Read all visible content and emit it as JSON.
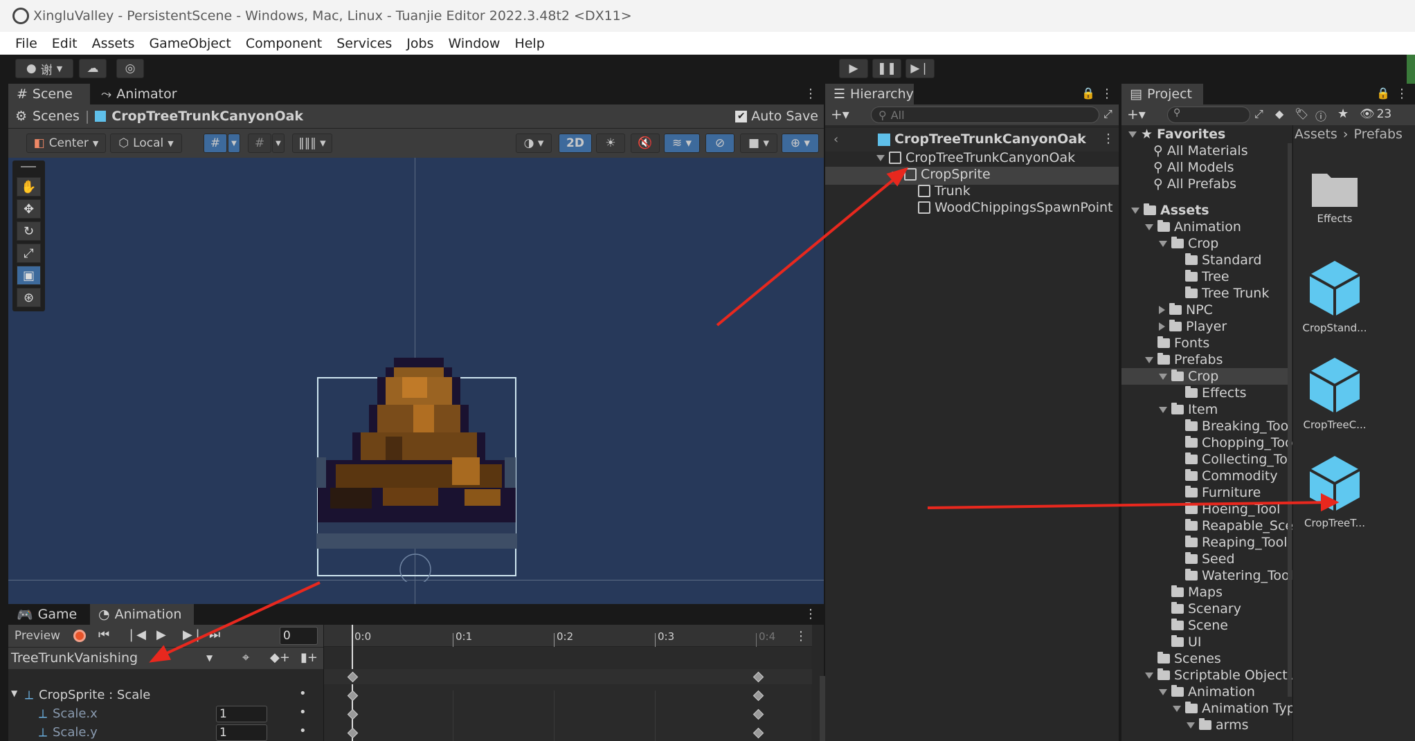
{
  "window": {
    "title": "XingluValley - PersistentScene - Windows, Mac, Linux - Tuanjie Editor 2022.3.48t2 <DX11>"
  },
  "menu": [
    "File",
    "Edit",
    "Assets",
    "GameObject",
    "Component",
    "Services",
    "Jobs",
    "Window",
    "Help"
  ],
  "toolbar": {
    "account_label": "谢",
    "play_icon": "play-icon",
    "pause_icon": "pause-icon",
    "step_icon": "step-icon"
  },
  "scene_panel": {
    "tabs": [
      "Scene",
      "Animator"
    ],
    "breadcrumb_root": "Scenes",
    "breadcrumb_prefab": "CropTreeTrunkCanyonOak",
    "auto_save": "Auto Save",
    "pivot": "Center",
    "space": "Local",
    "mode_2d": "2D"
  },
  "hierarchy": {
    "tab": "Hierarchy",
    "search_placeholder": "All",
    "root": "CropTreeTrunkCanyonOak",
    "items": [
      {
        "label": "CropTreeTrunkCanyonOak",
        "level": 1,
        "expanded": true
      },
      {
        "label": "CropSprite",
        "level": 2,
        "expanded": true,
        "selected": true
      },
      {
        "label": "Trunk",
        "level": 3
      },
      {
        "label": "WoodChippingsSpawnPoint",
        "level": 3
      }
    ]
  },
  "project": {
    "tab": "Project",
    "hidden_count": "23",
    "breadcrumb": [
      "Assets",
      "Prefabs"
    ],
    "favorites_label": "Favorites",
    "favorites": [
      "All Materials",
      "All Models",
      "All Prefabs"
    ],
    "tree": [
      {
        "label": "Assets",
        "level": 0,
        "arrow": "down",
        "bold": true
      },
      {
        "label": "Animation",
        "level": 1,
        "arrow": "down"
      },
      {
        "label": "Crop",
        "level": 2,
        "arrow": "down"
      },
      {
        "label": "Standard",
        "level": 3
      },
      {
        "label": "Tree",
        "level": 3
      },
      {
        "label": "Tree Trunk",
        "level": 3
      },
      {
        "label": "NPC",
        "level": 2,
        "arrow": "right"
      },
      {
        "label": "Player",
        "level": 2,
        "arrow": "right"
      },
      {
        "label": "Fonts",
        "level": 1
      },
      {
        "label": "Prefabs",
        "level": 1,
        "arrow": "down"
      },
      {
        "label": "Crop",
        "level": 2,
        "arrow": "down",
        "selected": true
      },
      {
        "label": "Effects",
        "level": 3
      },
      {
        "label": "Item",
        "level": 2,
        "arrow": "down"
      },
      {
        "label": "Breaking_Tool",
        "level": 3
      },
      {
        "label": "Chopping_Too",
        "level": 3
      },
      {
        "label": "Collecting_To",
        "level": 3
      },
      {
        "label": "Commodity",
        "level": 3
      },
      {
        "label": "Furniture",
        "level": 3
      },
      {
        "label": "Hoeing_Tool",
        "level": 3
      },
      {
        "label": "Reapable_Sce",
        "level": 3
      },
      {
        "label": "Reaping_Tool",
        "level": 3
      },
      {
        "label": "Seed",
        "level": 3
      },
      {
        "label": "Watering_Tool",
        "level": 3
      },
      {
        "label": "Maps",
        "level": 2
      },
      {
        "label": "Scenary",
        "level": 2
      },
      {
        "label": "Scene",
        "level": 2
      },
      {
        "label": "UI",
        "level": 2
      },
      {
        "label": "Scenes",
        "level": 1
      },
      {
        "label": "Scriptable Object A",
        "level": 1,
        "arrow": "down"
      },
      {
        "label": "Animation",
        "level": 2,
        "arrow": "down"
      },
      {
        "label": "Animation Typ",
        "level": 3,
        "arrow": "down"
      },
      {
        "label": "arms",
        "level": 4,
        "arrow": "down"
      }
    ],
    "assets": [
      {
        "label": "Effects",
        "kind": "folder"
      },
      {
        "label": "CropStand...",
        "kind": "prefab"
      },
      {
        "label": "CropTreeC...",
        "kind": "prefab"
      },
      {
        "label": "CropTreeT...",
        "kind": "prefab"
      }
    ]
  },
  "animation_panel": {
    "tabs": [
      "Game",
      "Animation"
    ],
    "preview": "Preview",
    "frame": "0",
    "clip": "TreeTrunkVanishing",
    "ruler": [
      "0:0",
      "0:1",
      "0:2",
      "0:3",
      "0:4"
    ],
    "properties": [
      {
        "label": "CropSprite : Scale",
        "value": ""
      },
      {
        "label": "Scale.x",
        "value": "1"
      },
      {
        "label": "Scale.y",
        "value": "1"
      }
    ]
  },
  "colors": {
    "accent": "#3d6a9c",
    "selection": "#2c5d87",
    "arrow": "#e8281e",
    "scene_bg": "#27395a"
  }
}
